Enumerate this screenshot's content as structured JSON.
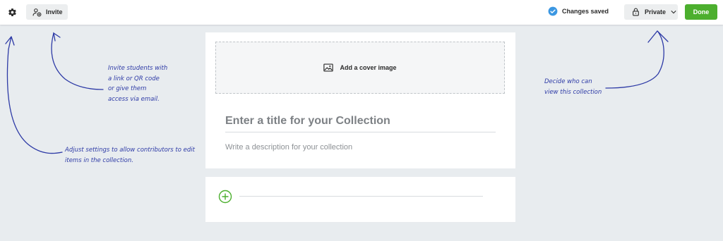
{
  "toolbar": {
    "settings_icon": "gear-icon",
    "invite_label": "Invite",
    "invite_icon": "person-add-icon",
    "status_label": "Changes saved",
    "status_icon": "check-circle-icon",
    "privacy_label": "Private",
    "privacy_icon": "lock-icon",
    "done_label": "Done",
    "accent_color": "#4caf2e",
    "status_color": "#3b97e2"
  },
  "collection": {
    "cover_label": "Add a cover image",
    "cover_icon": "image-icon",
    "title_placeholder": "Enter a title for your Collection",
    "description_placeholder": "Write a description for your collection",
    "add_icon": "plus-circle-icon"
  },
  "annotations": {
    "invite": [
      "Invite students with",
      "a link or QR code",
      "or give them",
      "access via email."
    ],
    "settings": [
      "Adjust settings to allow contributors to edit",
      "items in the collection."
    ],
    "privacy": [
      "Decide who can",
      "view this collection"
    ],
    "color": "#2d3aa6"
  }
}
